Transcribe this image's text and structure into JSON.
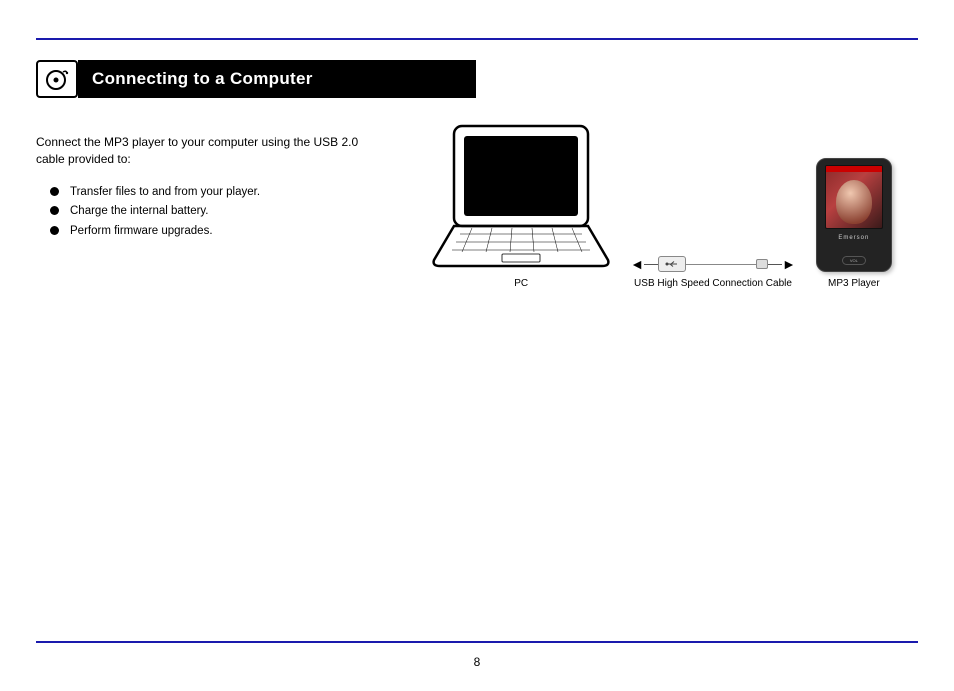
{
  "section": {
    "title": "Connecting to a Computer"
  },
  "intro": "Connect the MP3 player to your computer using the USB 2.0 cable provided to:",
  "bullets": [
    "Transfer files to and from your player.",
    "Charge the internal battery.",
    "Perform firmware upgrades."
  ],
  "labels": {
    "pc": "PC",
    "cable": "USB High Speed Connection Cable",
    "mp3": "MP3 Player"
  },
  "mp3_brand": "Emerson",
  "mp3_button": "VOL",
  "page_number": "8"
}
